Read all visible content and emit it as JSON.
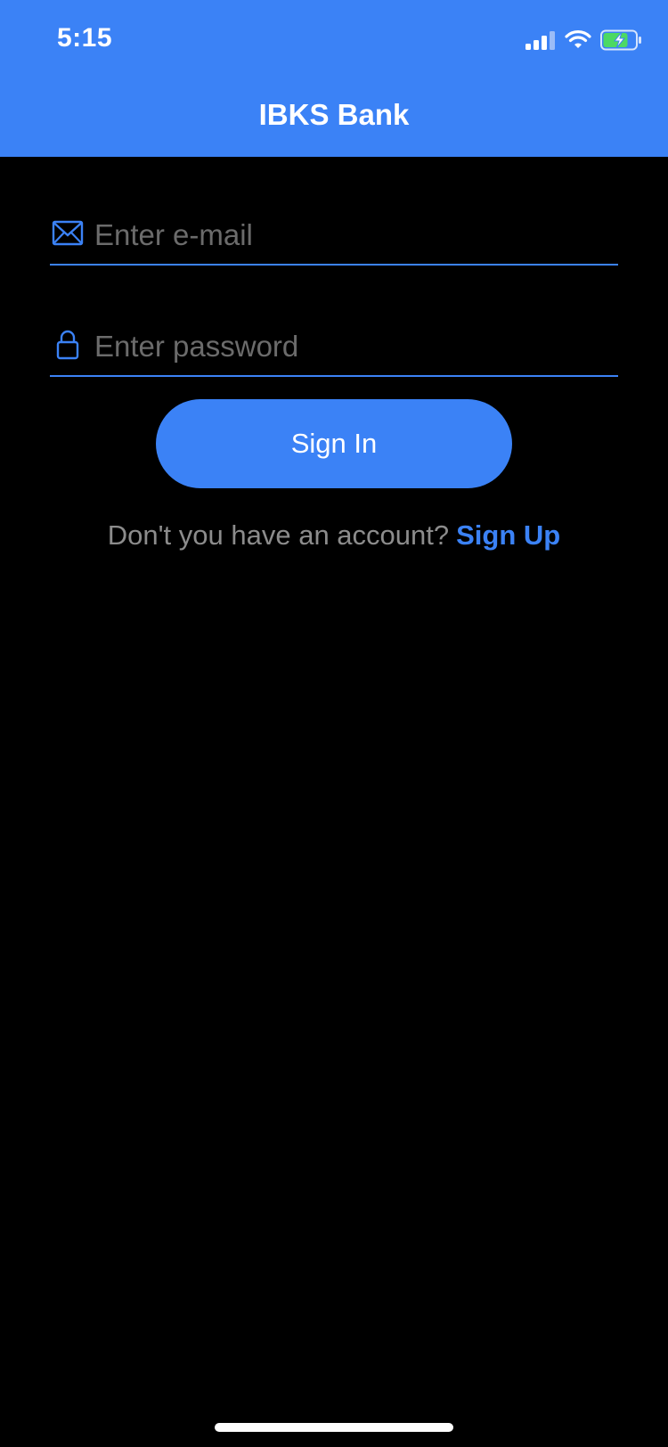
{
  "status_bar": {
    "time": "5:15",
    "icons": [
      "signal-icon",
      "wifi-icon",
      "battery-charging-icon"
    ]
  },
  "nav": {
    "title": "IBKS Bank"
  },
  "form": {
    "email": {
      "value": "",
      "placeholder": "Enter e-mail",
      "icon": "mail-icon"
    },
    "password": {
      "value": "",
      "placeholder": "Enter password",
      "icon": "lock-icon"
    },
    "sign_in_label": "Sign In"
  },
  "footer": {
    "prompt": "Don't you have an account?",
    "link": "Sign Up"
  },
  "colors": {
    "accent": "#3b82f6",
    "background": "#000000",
    "battery_fill": "#4cd964"
  }
}
